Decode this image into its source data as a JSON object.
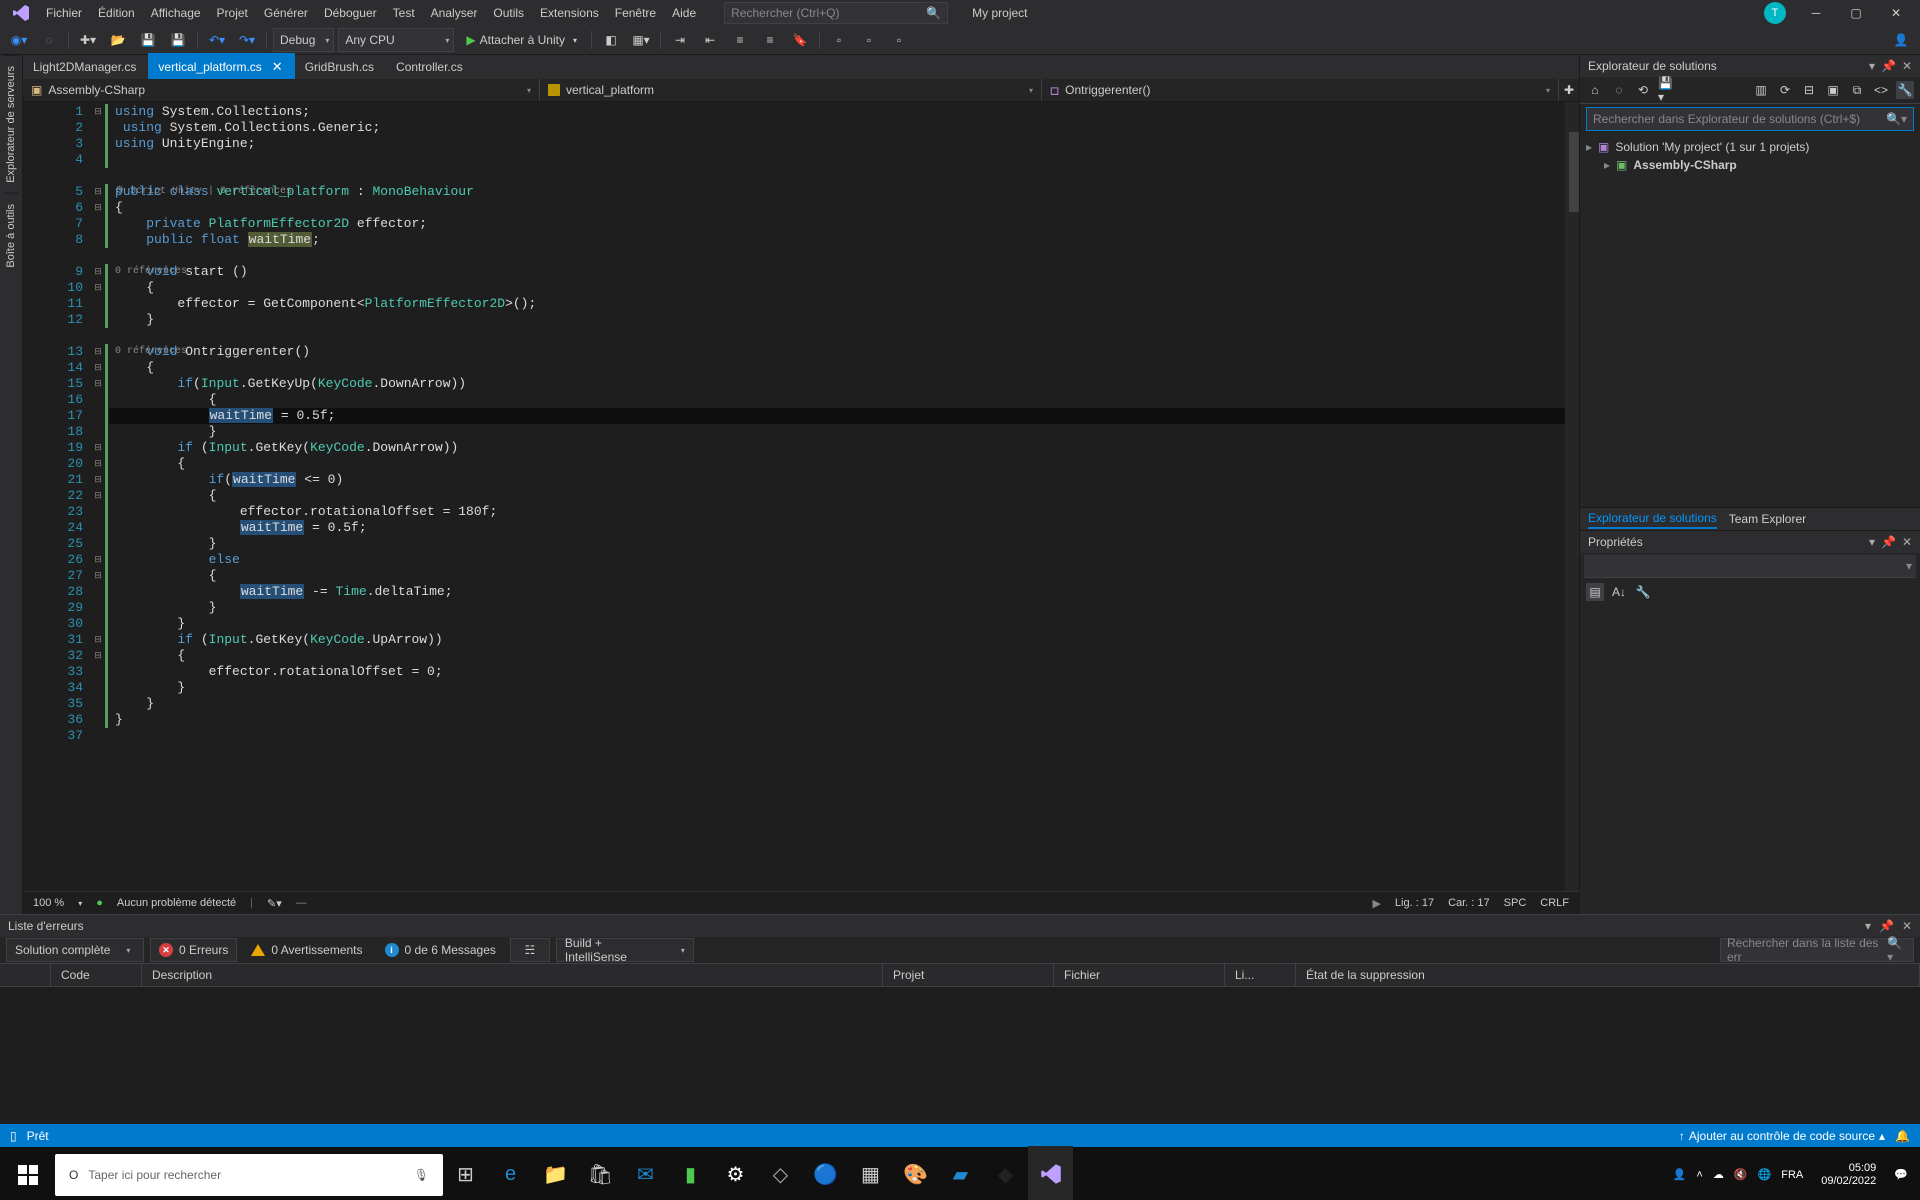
{
  "menubar": {
    "items": [
      "Fichier",
      "Édition",
      "Affichage",
      "Projet",
      "Générer",
      "Déboguer",
      "Test",
      "Analyser",
      "Outils",
      "Extensions",
      "Fenêtre",
      "Aide"
    ],
    "search_placeholder": "Rechercher (Ctrl+Q)",
    "project_name": "My project",
    "avatar_initial": "T"
  },
  "toolbar": {
    "config": "Debug",
    "platform": "Any CPU",
    "attach_label": "Attacher à Unity"
  },
  "left_rail": {
    "tabs": [
      "Explorateur de serveurs",
      "Boîte à outils"
    ]
  },
  "doc_tabs": {
    "tabs": [
      {
        "label": "Light2DManager.cs",
        "active": false
      },
      {
        "label": "vertical_platform.cs",
        "active": true
      },
      {
        "label": "GridBrush.cs",
        "active": false
      },
      {
        "label": "Controller.cs",
        "active": false
      }
    ]
  },
  "nav_bar": {
    "left": "Assembly-CSharp",
    "mid": "vertical_platform",
    "right": "Ontriggerenter()"
  },
  "code": {
    "lines": [
      {
        "n": 1,
        "g": true,
        "html": "<span class='kw'>using</span> System.Collections;"
      },
      {
        "n": 2,
        "g": true,
        "html": " <span class='kw'>using</span> System.Collections.Generic;"
      },
      {
        "n": 3,
        "g": true,
        "html": "<span class='kw'>using</span> UnityEngine;"
      },
      {
        "n": 4,
        "g": true,
        "html": ""
      },
      {
        "codelens": true,
        "html": " <span class='codelens'>⚙ Script Unity | 0 références</span>"
      },
      {
        "n": 5,
        "g": true,
        "html": "<span class='kw'>public</span> <span class='kw'>class</span> <span class='type'>vertical_platform</span> : <span class='type'>MonoBehaviour</span>"
      },
      {
        "n": 6,
        "g": true,
        "html": "{"
      },
      {
        "n": 7,
        "g": true,
        "html": "    <span class='kw'>private</span> <span class='type'>PlatformEffector2D</span> effector;"
      },
      {
        "n": 8,
        "g": true,
        "html": "    <span class='kw'>public</span> <span class='kw'>float</span> <span class='hl2'>waitTime</span>;"
      },
      {
        "codelens": true,
        "html": "    <span class='codelens'>0 références</span>"
      },
      {
        "n": 9,
        "g": true,
        "html": "    <span class='kw'>void</span> <span>start</span> ()"
      },
      {
        "n": 10,
        "g": true,
        "html": "    {"
      },
      {
        "n": 11,
        "g": true,
        "html": "        effector = GetComponent&lt;<span class='type'>PlatformEffector2D</span>&gt;();"
      },
      {
        "n": 12,
        "g": true,
        "html": "    }"
      },
      {
        "codelens": true,
        "html": "    <span class='codelens'>0 références</span>"
      },
      {
        "n": 13,
        "g": true,
        "html": "    <span class='kw'>void</span> <span>Ontriggerenter</span>()"
      },
      {
        "n": 14,
        "g": true,
        "html": "    {"
      },
      {
        "n": 15,
        "g": true,
        "html": "        <span class='kw'>if</span>(<span class='type'>Input</span>.GetKeyUp(<span class='type'>KeyCode</span>.DownArrow))"
      },
      {
        "n": 16,
        "g": true,
        "html": "            {"
      },
      {
        "n": 17,
        "g": true,
        "cur": true,
        "html": "            <span class='hl'>waitTime</span> = 0.5f;"
      },
      {
        "n": 18,
        "g": true,
        "html": "            }"
      },
      {
        "n": 19,
        "g": true,
        "html": "        <span class='kw'>if</span> (<span class='type'>Input</span>.GetKey(<span class='type'>KeyCode</span>.DownArrow))"
      },
      {
        "n": 20,
        "g": true,
        "html": "        {"
      },
      {
        "n": 21,
        "g": true,
        "html": "            <span class='kw'>if</span>(<span class='hl'>waitTime</span> &lt;= 0)"
      },
      {
        "n": 22,
        "g": true,
        "html": "            {"
      },
      {
        "n": 23,
        "g": true,
        "html": "                effector.rotationalOffset = 180f;"
      },
      {
        "n": 24,
        "g": true,
        "html": "                <span class='hl'>waitTime</span> = 0.5f;"
      },
      {
        "n": 25,
        "g": true,
        "html": "            }"
      },
      {
        "n": 26,
        "g": true,
        "html": "            <span class='kw'>else</span>"
      },
      {
        "n": 27,
        "g": true,
        "html": "            {"
      },
      {
        "n": 28,
        "g": true,
        "html": "                <span class='hl'>waitTime</span> -= <span class='type'>Time</span>.deltaTime;"
      },
      {
        "n": 29,
        "g": true,
        "html": "            }"
      },
      {
        "n": 30,
        "g": true,
        "html": "        }"
      },
      {
        "n": 31,
        "g": true,
        "html": "        <span class='kw'>if</span> (<span class='type'>Input</span>.GetKey(<span class='type'>KeyCode</span>.UpArrow))"
      },
      {
        "n": 32,
        "g": true,
        "html": "        {"
      },
      {
        "n": 33,
        "g": true,
        "html": "            effector.rotationalOffset = 0;"
      },
      {
        "n": 34,
        "g": true,
        "html": "        }"
      },
      {
        "n": 35,
        "g": true,
        "html": "    }"
      },
      {
        "n": 36,
        "g": true,
        "html": "}"
      },
      {
        "n": 37,
        "g": false,
        "html": ""
      }
    ]
  },
  "editor_status": {
    "zoom": "100 %",
    "problems": "Aucun problème détecté",
    "line": "Lig. : 17",
    "col": "Car. : 17",
    "spc": "SPC",
    "crlf": "CRLF"
  },
  "solution_explorer": {
    "title": "Explorateur de solutions",
    "search_placeholder": "Rechercher dans Explorateur de solutions (Ctrl+$)",
    "root": "Solution 'My project' (1 sur 1 projets)",
    "project": "Assembly-CSharp",
    "bottom_tabs": [
      "Explorateur de solutions",
      "Team Explorer"
    ]
  },
  "properties": {
    "title": "Propriétés"
  },
  "error_list": {
    "title": "Liste d'erreurs",
    "scope": "Solution complète",
    "errors": "0 Erreurs",
    "warnings": "0 Avertissements",
    "messages": "0 de 6 Messages",
    "build": "Build + IntelliSense",
    "search_placeholder": "Rechercher dans la liste des err",
    "columns": [
      "",
      "Code",
      "Description",
      "Projet",
      "Fichier",
      "Li...",
      "État de la suppression"
    ]
  },
  "statusbar": {
    "ready": "Prêt",
    "source_control": "Ajouter au contrôle de code source"
  },
  "taskbar": {
    "search_placeholder": "Taper ici pour rechercher",
    "time": "05:09",
    "date": "09/02/2022"
  }
}
